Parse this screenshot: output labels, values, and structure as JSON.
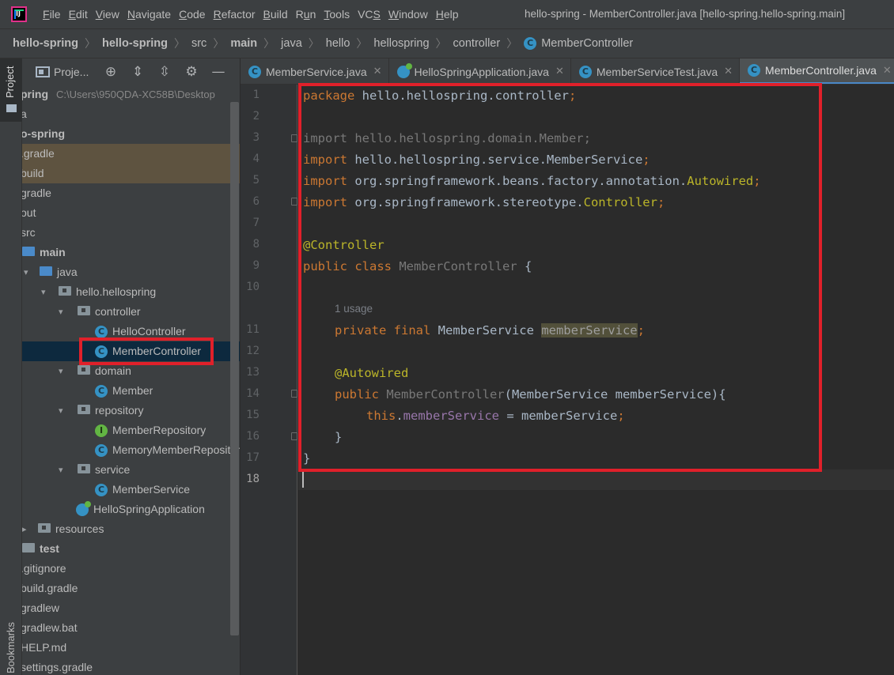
{
  "window": {
    "title": "hello-spring - MemberController.java [hello-spring.hello-spring.main]"
  },
  "menu": [
    {
      "label": "File",
      "mnemonic": "F",
      "rest": "ile"
    },
    {
      "label": "Edit",
      "mnemonic": "E",
      "rest": "dit"
    },
    {
      "label": "View",
      "mnemonic": "V",
      "rest": "iew"
    },
    {
      "label": "Navigate",
      "mnemonic": "N",
      "rest": "avigate"
    },
    {
      "label": "Code",
      "mnemonic": "C",
      "rest": "ode"
    },
    {
      "label": "Refactor",
      "mnemonic": "R",
      "rest": "efactor"
    },
    {
      "label": "Build",
      "mnemonic": "B",
      "rest": "uild"
    },
    {
      "label": "Run",
      "mnemonic": "u",
      "pre": "R",
      "rest": "n"
    },
    {
      "label": "Tools",
      "mnemonic": "T",
      "rest": "ools"
    },
    {
      "label": "VCS",
      "mnemonic": "S",
      "pre": "VC",
      "rest": ""
    },
    {
      "label": "Window",
      "mnemonic": "W",
      "rest": "indow"
    },
    {
      "label": "Help",
      "mnemonic": "H",
      "rest": "elp"
    }
  ],
  "breadcrumb": [
    "hello-spring",
    "hello-spring",
    "src",
    "main",
    "java",
    "hello",
    "hellospring",
    "controller",
    "MemberController"
  ],
  "project_panel": {
    "title": "Proje...",
    "root_label": "pring",
    "root_path": "C:\\Users\\950QDA-XC58B\\Desktop",
    "tree": [
      {
        "label": "a"
      },
      {
        "label": "o-spring",
        "bold": true
      },
      {
        "label": ".gradle"
      },
      {
        "label": "build"
      },
      {
        "label": "gradle"
      },
      {
        "label": "out"
      },
      {
        "label": "src"
      },
      {
        "label": "main",
        "bold": true
      },
      {
        "label": "java"
      },
      {
        "label": "hello.hellospring"
      },
      {
        "label": "controller"
      },
      {
        "label": "HelloController"
      },
      {
        "label": "MemberController"
      },
      {
        "label": "domain"
      },
      {
        "label": "Member"
      },
      {
        "label": "repository"
      },
      {
        "label": "MemberRepository"
      },
      {
        "label": "MemoryMemberRepositor"
      },
      {
        "label": "service"
      },
      {
        "label": "MemberService"
      },
      {
        "label": "HelloSpringApplication"
      },
      {
        "label": "resources"
      },
      {
        "label": "test",
        "bold": true
      },
      {
        "label": ".gitignore"
      },
      {
        "label": "build.gradle"
      },
      {
        "label": "gradlew"
      },
      {
        "label": "gradlew.bat"
      },
      {
        "label": "HELP.md"
      },
      {
        "label": "settings.gradle"
      }
    ]
  },
  "side_stripe": {
    "project": "Project",
    "bookmarks": "Bookmarks"
  },
  "tabs": [
    {
      "label": "MemberService.java",
      "icon": "class-icon",
      "closable": true
    },
    {
      "label": "HelloSpringApplication.java",
      "icon": "spring-app-icon",
      "closable": true
    },
    {
      "label": "MemberServiceTest.java",
      "icon": "test-class-icon",
      "closable": true
    },
    {
      "label": "MemberController.java",
      "icon": "class-icon",
      "closable": true,
      "active": true
    }
  ],
  "editor": {
    "line_numbers": [
      "1",
      "2",
      "3",
      "4",
      "5",
      "6",
      "7",
      "8",
      "9",
      "10",
      "11",
      "12",
      "13",
      "14",
      "15",
      "16",
      "17",
      "18"
    ],
    "usage_hint": "1 usage",
    "code": {
      "l1": [
        "package",
        " hello.hellospring.controller",
        ";"
      ],
      "l3": [
        "import",
        " hello.hellospring.domain.Member;"
      ],
      "l4": [
        "import",
        " hello.hellospring.service.MemberService",
        ";"
      ],
      "l5": [
        "import",
        " org.springframework.beans.factory.annotation.",
        "Autowired",
        ";"
      ],
      "l6": [
        "import",
        " org.springframework.stereotype.",
        "Controller",
        ";"
      ],
      "l8": [
        "@Controller"
      ],
      "l9": [
        "public class",
        " MemberController",
        " {"
      ],
      "l11": [
        "private final",
        " MemberService ",
        "memberService",
        ";"
      ],
      "l13": [
        "@Autowired"
      ],
      "l14": [
        "public",
        " MemberController",
        "(MemberService memberService){"
      ],
      "l15": [
        "this",
        ".",
        "memberService",
        " = memberService",
        ";"
      ],
      "l16": [
        "}"
      ],
      "l17": [
        "}"
      ]
    }
  },
  "colors": {
    "keyword": "#cc7832",
    "annotation": "#bbb529",
    "field": "#9876aa",
    "plain": "#a9b7c6",
    "highlight_box": "#e0202a",
    "selection": "#0d293e"
  }
}
